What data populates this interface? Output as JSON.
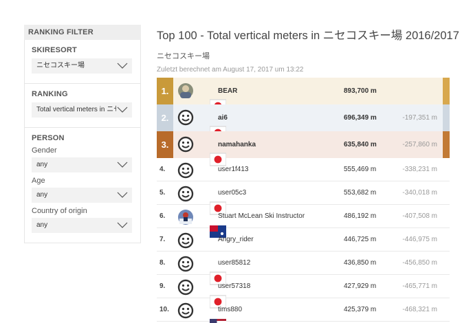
{
  "filter": {
    "title": "RANKING FILTER",
    "skiresort": {
      "label": "SKIRESORT",
      "value": "ニセコスキー場"
    },
    "ranking": {
      "label": "RANKING",
      "value": "Total vertical meters in ニセコスキー場"
    },
    "person": {
      "label": "PERSON",
      "gender": {
        "label": "Gender",
        "value": "any"
      },
      "age": {
        "label": "Age",
        "value": "any"
      },
      "country": {
        "label": "Country of origin",
        "value": "any"
      }
    }
  },
  "main": {
    "title": "Top 100 - Total vertical meters in ニセコスキー場 2016/2017",
    "subtitle": "ニセコスキー場",
    "timestamp": "Zuletzt berechnet am August 17, 2017 um 13:22"
  },
  "rows": [
    {
      "rank": "1.",
      "name": "BEAR",
      "value": "893,700 m",
      "diff": "",
      "avatar": "photo-bear",
      "flag": "red-dot"
    },
    {
      "rank": "2.",
      "name": "ai6",
      "value": "696,349 m",
      "diff": "-197,351 m",
      "avatar": "smiley",
      "flag": "red-dot"
    },
    {
      "rank": "3.",
      "name": "namahanka",
      "value": "635,840 m",
      "diff": "-257,860 m",
      "avatar": "smiley",
      "flag": "red-dot"
    },
    {
      "rank": "4.",
      "name": "user1f413",
      "value": "555,469 m",
      "diff": "-338,231 m",
      "avatar": "smiley",
      "flag": ""
    },
    {
      "rank": "5.",
      "name": "user05c3",
      "value": "553,682 m",
      "diff": "-340,018 m",
      "avatar": "smiley",
      "flag": "red-dot"
    },
    {
      "rank": "6.",
      "name": "Stuart McLean Ski Instructor",
      "value": "486,192 m",
      "diff": "-407,508 m",
      "avatar": "photo-skier",
      "flag": "au"
    },
    {
      "rank": "7.",
      "name": "Angry_rider",
      "value": "446,725 m",
      "diff": "-446,975 m",
      "avatar": "smiley",
      "flag": ""
    },
    {
      "rank": "8.",
      "name": "user85812",
      "value": "436,850 m",
      "diff": "-456,850 m",
      "avatar": "smiley",
      "flag": "red-dot"
    },
    {
      "rank": "9.",
      "name": "user57318",
      "value": "427,929 m",
      "diff": "-465,771 m",
      "avatar": "smiley",
      "flag": "red-dot"
    },
    {
      "rank": "10.",
      "name": "tims880",
      "value": "425,379 m",
      "diff": "-468,321 m",
      "avatar": "smiley",
      "flag": "us"
    }
  ]
}
